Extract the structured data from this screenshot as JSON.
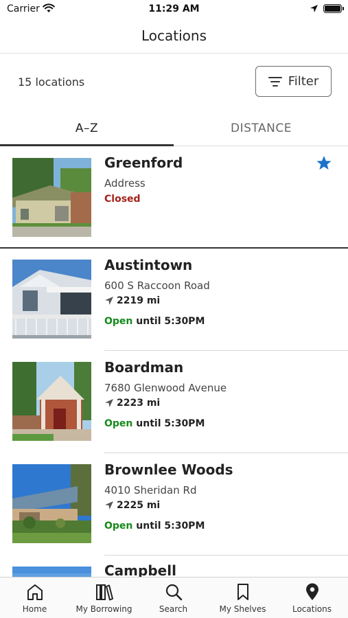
{
  "status_bar": {
    "carrier": "Carrier",
    "time": "11:29 AM"
  },
  "nav": {
    "title": "Locations"
  },
  "summary": {
    "count_label": "15 locations",
    "filter_label": "Filter"
  },
  "tabs": [
    {
      "label": "A–Z",
      "active": true
    },
    {
      "label": "DISTANCE",
      "active": false
    }
  ],
  "locations": [
    {
      "name": "Greenford",
      "address": "Address",
      "status": "Closed",
      "favorite": true
    },
    {
      "name": "Austintown",
      "address": "600 S Raccoon Road",
      "distance": "2219 mi",
      "open_word": "Open",
      "open_until": "until 5:30PM"
    },
    {
      "name": "Boardman",
      "address": "7680 Glenwood Avenue",
      "distance": "2223 mi",
      "open_word": "Open",
      "open_until": "until 5:30PM"
    },
    {
      "name": "Brownlee Woods",
      "address": "4010 Sheridan Rd",
      "distance": "2225 mi",
      "open_word": "Open",
      "open_until": "until 5:30PM"
    },
    {
      "name": "Campbell"
    }
  ],
  "tab_bar": [
    {
      "label": "Home",
      "icon": "home-icon"
    },
    {
      "label": "My Borrowing",
      "icon": "books-icon"
    },
    {
      "label": "Search",
      "icon": "search-icon"
    },
    {
      "label": "My Shelves",
      "icon": "bookmark-icon"
    },
    {
      "label": "Locations",
      "icon": "location-pin-icon"
    }
  ],
  "colors": {
    "closed": "#a32119",
    "open": "#168a1c",
    "favorite": "#1a73c9"
  }
}
